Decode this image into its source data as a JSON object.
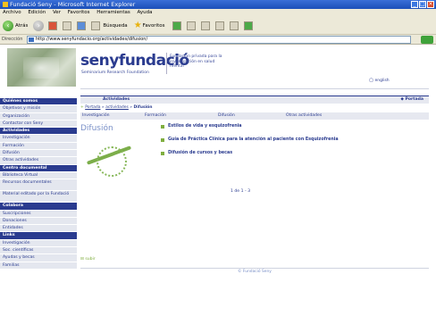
{
  "browser": {
    "title": "Fundació Seny - Microsoft Internet Explorer",
    "menu": [
      "Archivo",
      "Edición",
      "Ver",
      "Favoritos",
      "Herramientas",
      "Ayuda"
    ],
    "toolbar": {
      "back_label": "Atrás",
      "search_label": "Búsqueda",
      "favorites_label": "Favoritos"
    },
    "address_label": "Dirección",
    "address_value": "http://www.senyfundacio.org/actividades/difusion/"
  },
  "header": {
    "logo": "senyfundació",
    "logo_sub": "Seminarium Research Foundation",
    "tagline": "Fundación privada para la investigación en salud mental",
    "lang_link": "english"
  },
  "sidebar": {
    "items": [
      {
        "label": "Quiénes somos",
        "type": "section"
      },
      {
        "label": "Objetivos y misión",
        "type": "item"
      },
      {
        "label": "Organización",
        "type": "item"
      },
      {
        "label": "Contactar con Seny",
        "type": "item"
      },
      {
        "label": "Actividades",
        "type": "section"
      },
      {
        "label": "Investigación",
        "type": "item"
      },
      {
        "label": "Formación",
        "type": "item"
      },
      {
        "label": "Difusión",
        "type": "item"
      },
      {
        "label": "Otras actividades",
        "type": "item"
      },
      {
        "label": "Centro documental",
        "type": "section"
      },
      {
        "label": "Biblioteca Virtual",
        "type": "item"
      },
      {
        "label": "Recursos documentales",
        "type": "multi"
      },
      {
        "label": "Material editado por la Fundació",
        "type": "multi"
      },
      {
        "label": "Colabora",
        "type": "section"
      },
      {
        "label": "Suscripciones",
        "type": "item"
      },
      {
        "label": "Donaciones",
        "type": "item"
      },
      {
        "label": "Entidades",
        "type": "item"
      },
      {
        "label": "Links",
        "type": "section"
      },
      {
        "label": "Investigación",
        "type": "item"
      },
      {
        "label": "Soc. científicas",
        "type": "item"
      },
      {
        "label": "Ayudas y becas",
        "type": "item"
      },
      {
        "label": "Familias",
        "type": "item"
      }
    ]
  },
  "content": {
    "bar_title": "Actividades",
    "bar_right": "Portada",
    "breadcrumb": {
      "home": "Portada",
      "sep1": " » ",
      "parent": "actividades",
      "sep2": " » ",
      "current": "Difusión"
    },
    "tabs": [
      "Investigación",
      "Formación",
      "Difusión",
      "Otras actividades"
    ],
    "section_title": "Difusión",
    "links": [
      "Estilos de vida y esquizofrenia",
      "Guía de Práctica Clínica para la atención al paciente con Esquizofrenia",
      "Difusión de cursos y becas"
    ],
    "pager": "1 de 1 - 3",
    "up_link": "subir",
    "footer": "© Fundació Seny"
  }
}
